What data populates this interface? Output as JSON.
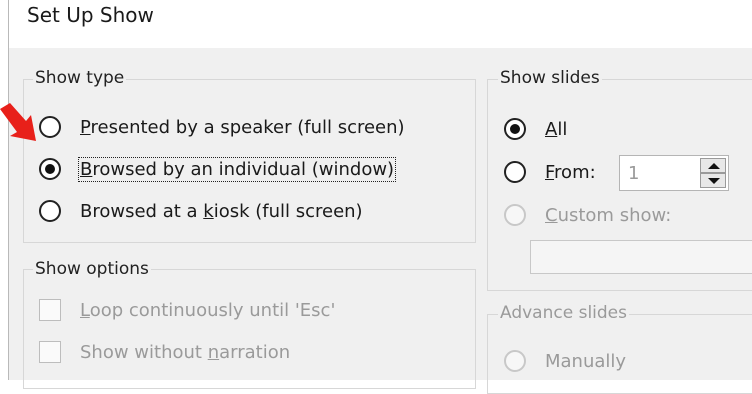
{
  "dialog": {
    "title": "Set Up Show"
  },
  "show_type": {
    "label": "Show type",
    "options": [
      {
        "pre": "",
        "key": "P",
        "post": "resented by a speaker (full screen)",
        "checked": false
      },
      {
        "pre": "",
        "key": "B",
        "post": "rowsed by an individual (window)",
        "checked": true
      },
      {
        "pre": "Browsed at a ",
        "key": "k",
        "post": "iosk (full screen)",
        "checked": false
      }
    ]
  },
  "show_options": {
    "label": "Show options",
    "items": [
      {
        "pre": "",
        "key": "L",
        "post": "oop continuously until 'Esc'"
      },
      {
        "pre": "Show without ",
        "key": "n",
        "post": "arration"
      }
    ]
  },
  "show_slides": {
    "label": "Show slides",
    "all": {
      "pre": "",
      "key": "A",
      "post": "ll",
      "checked": true
    },
    "from": {
      "pre": "",
      "key": "F",
      "post": "rom:",
      "value": "1"
    },
    "custom": {
      "pre": "",
      "key": "C",
      "post": "ustom show:"
    }
  },
  "advance_slides": {
    "label": "Advance slides",
    "manually": "Manually"
  },
  "annotation": {
    "arrow_color": "#e8201a",
    "icon": "red-arrow-icon"
  }
}
